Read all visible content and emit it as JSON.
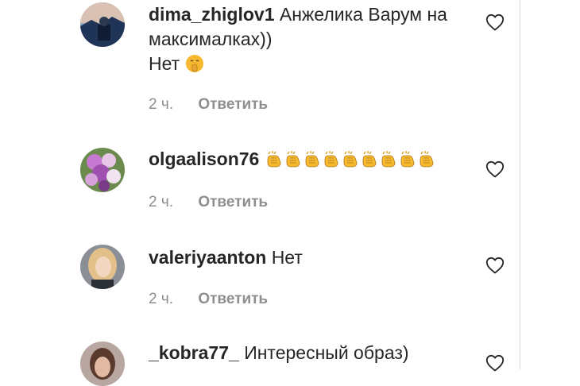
{
  "comments": [
    {
      "username": "dima_zhiglov1",
      "text": "Анжелика Варум на максималках))",
      "line2": "Нет",
      "emoji": "shushing-face",
      "time": "2 ч.",
      "reply": "Ответить"
    },
    {
      "username": "olgaalison76",
      "text": "",
      "emoji": "clapping-hands",
      "emoji_count": 9,
      "time": "2 ч.",
      "reply": "Ответить"
    },
    {
      "username": "valeriyaanton",
      "text": "Нет",
      "time": "2 ч.",
      "reply": "Ответить"
    },
    {
      "username": "_kobra77_",
      "text": "Интересный образ)"
    }
  ],
  "colors": {
    "text": "#262626",
    "meta": "#8e8e8e",
    "border": "#dbdbdb",
    "emoji_yellow": "#f5b82e"
  },
  "icons": {
    "like": "heart-outline-icon",
    "clap": "clapping-hands-emoji",
    "shush": "shushing-face-emoji"
  }
}
